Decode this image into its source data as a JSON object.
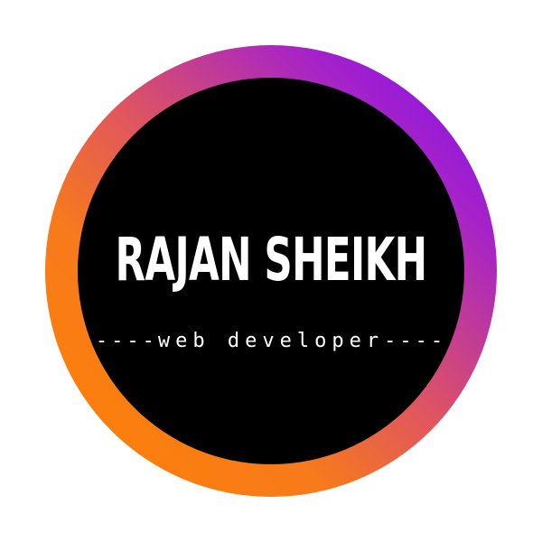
{
  "logo": {
    "name": "RAJAN SHEIKH",
    "tagline_prefix": "----",
    "tagline": "web developer",
    "tagline_suffix": "----"
  },
  "colors": {
    "background": "#ffffff",
    "disc": "#000000",
    "text": "#ffffff",
    "ring_gradient": [
      "#7b0cf5",
      "#a623c8",
      "#e2585a",
      "#f77a1c",
      "#ff8200"
    ]
  }
}
